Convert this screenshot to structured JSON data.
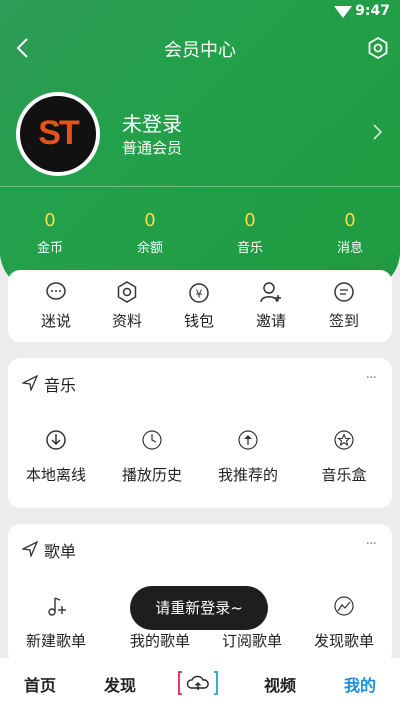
{
  "status": {
    "time": "9:47"
  },
  "header": {
    "title": "会员中心"
  },
  "profile": {
    "avatar_text": "ST",
    "name": "未登录",
    "level": "普通会员"
  },
  "stats": [
    {
      "value": "0",
      "label": "金币"
    },
    {
      "value": "0",
      "label": "余额"
    },
    {
      "value": "0",
      "label": "音乐"
    },
    {
      "value": "0",
      "label": "消息"
    }
  ],
  "quick_actions": [
    {
      "label": "迷说",
      "icon": "chat-bubble-icon"
    },
    {
      "label": "资料",
      "icon": "gear-icon"
    },
    {
      "label": "钱包",
      "icon": "wallet-yen-icon"
    },
    {
      "label": "邀请",
      "icon": "add-user-icon"
    },
    {
      "label": "签到",
      "icon": "sign-in-icon"
    }
  ],
  "music_section": {
    "title": "音乐",
    "more": "···",
    "items": [
      {
        "label": "本地离线",
        "icon": "download-circle-icon"
      },
      {
        "label": "播放历史",
        "icon": "clock-icon"
      },
      {
        "label": "我推荐的",
        "icon": "upload-circle-icon"
      },
      {
        "label": "音乐盒",
        "icon": "star-circle-icon"
      }
    ]
  },
  "playlist_section": {
    "title": "歌单",
    "more": "···",
    "items": [
      {
        "label": "新建歌单",
        "icon": "add-music-icon"
      },
      {
        "label": "我的歌单",
        "icon": "playlist-icon"
      },
      {
        "label": "订阅歌单",
        "icon": "subscribe-icon"
      },
      {
        "label": "发现歌单",
        "icon": "discover-icon"
      }
    ]
  },
  "toast": "请重新登录~",
  "tabbar": {
    "tabs": [
      {
        "label": "首页",
        "active": false
      },
      {
        "label": "发现",
        "active": false
      },
      {
        "label": "视频",
        "active": false
      },
      {
        "label": "我的",
        "active": true
      }
    ],
    "center_icon": "upload-cloud-icon"
  },
  "colors": {
    "header_green": "#22a04a",
    "stat_yellow": "#ffd84a",
    "active_tab": "#1a8fe0"
  }
}
